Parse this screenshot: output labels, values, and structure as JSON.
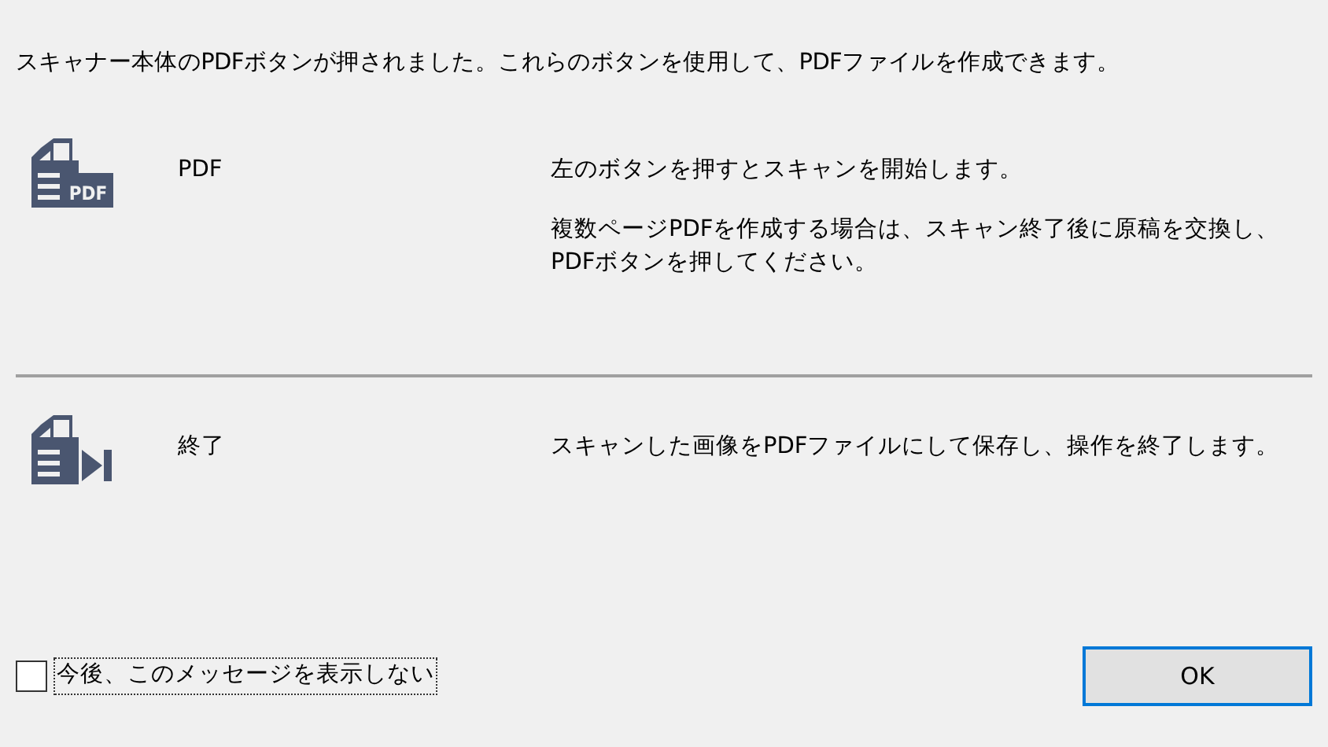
{
  "intro": "スキャナー本体のPDFボタンが押されました。これらのボタンを使用して、PDFファイルを作成できます。",
  "actions": [
    {
      "kind": "pdf",
      "icon_label": "PDF",
      "label": "PDF",
      "description": [
        "左のボタンを押すとスキャンを開始します。",
        "複数ページPDFを作成する場合は、スキャン終了後に原稿を交換し、PDFボタンを押してください。"
      ]
    },
    {
      "kind": "finish",
      "label": "終了",
      "description": [
        "スキャンした画像をPDFファイルにして保存し、操作を終了します。"
      ]
    }
  ],
  "dont_show": {
    "label": "今後、このメッセージを表示しない",
    "checked": false
  },
  "ok_button": "OK"
}
